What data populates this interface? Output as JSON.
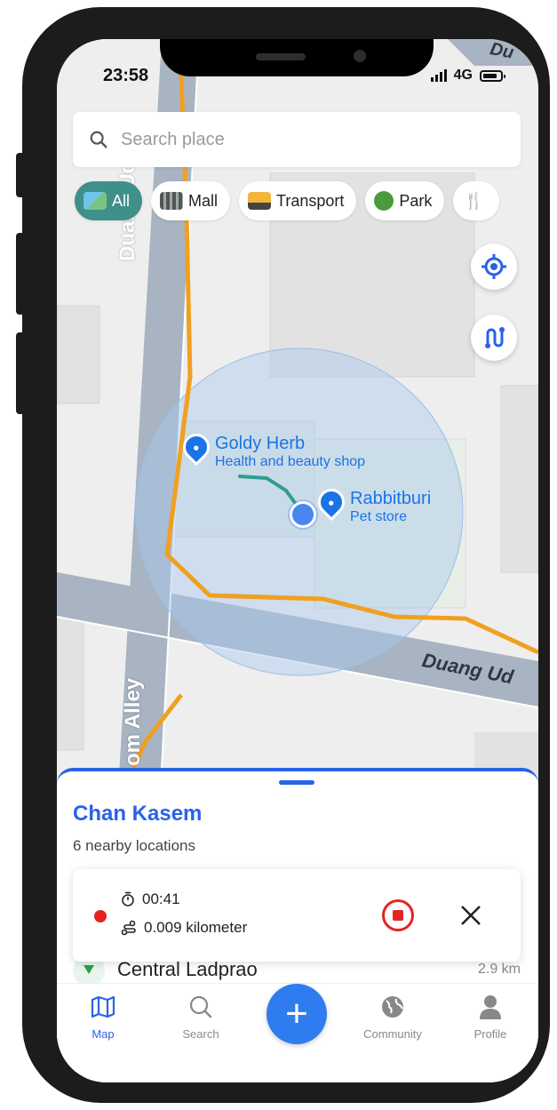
{
  "status_bar": {
    "time": "23:58",
    "network": "4G"
  },
  "search": {
    "placeholder": "Search place"
  },
  "categories": [
    {
      "label": "All",
      "active": true,
      "icon": "map-emoji-icon"
    },
    {
      "label": "Mall",
      "active": false,
      "icon": "building-emoji-icon"
    },
    {
      "label": "Transport",
      "active": false,
      "icon": "bus-emoji-icon"
    },
    {
      "label": "Park",
      "active": false,
      "icon": "tree-emoji-icon"
    }
  ],
  "map": {
    "roads": {
      "vertical_1": "Duang Ud",
      "vertical_2": "om Alley",
      "horizontal": "Duang Ud",
      "top_right": "Du"
    },
    "pois": [
      {
        "name": "Goldy Herb",
        "category": "Health and beauty shop"
      },
      {
        "name": "Rabbitburi",
        "category": "Pet store"
      }
    ],
    "colors": {
      "route": "#f0a020",
      "track": "#2e9e8e",
      "radius_fill": "#a8c8f0",
      "road": "#a8b4c2"
    }
  },
  "sheet": {
    "title": "Chan Kasem",
    "subtitle": "6 nearby locations",
    "list": [
      {
        "name": "Central Ladprao",
        "distance": "2.9 km"
      }
    ]
  },
  "tracking": {
    "elapsed": "00:41",
    "distance": "0.009 kilometer"
  },
  "tabbar": {
    "map": "Map",
    "search": "Search",
    "add": "+",
    "community": "Community",
    "profile": "Profile"
  },
  "accent": "#2962e8"
}
